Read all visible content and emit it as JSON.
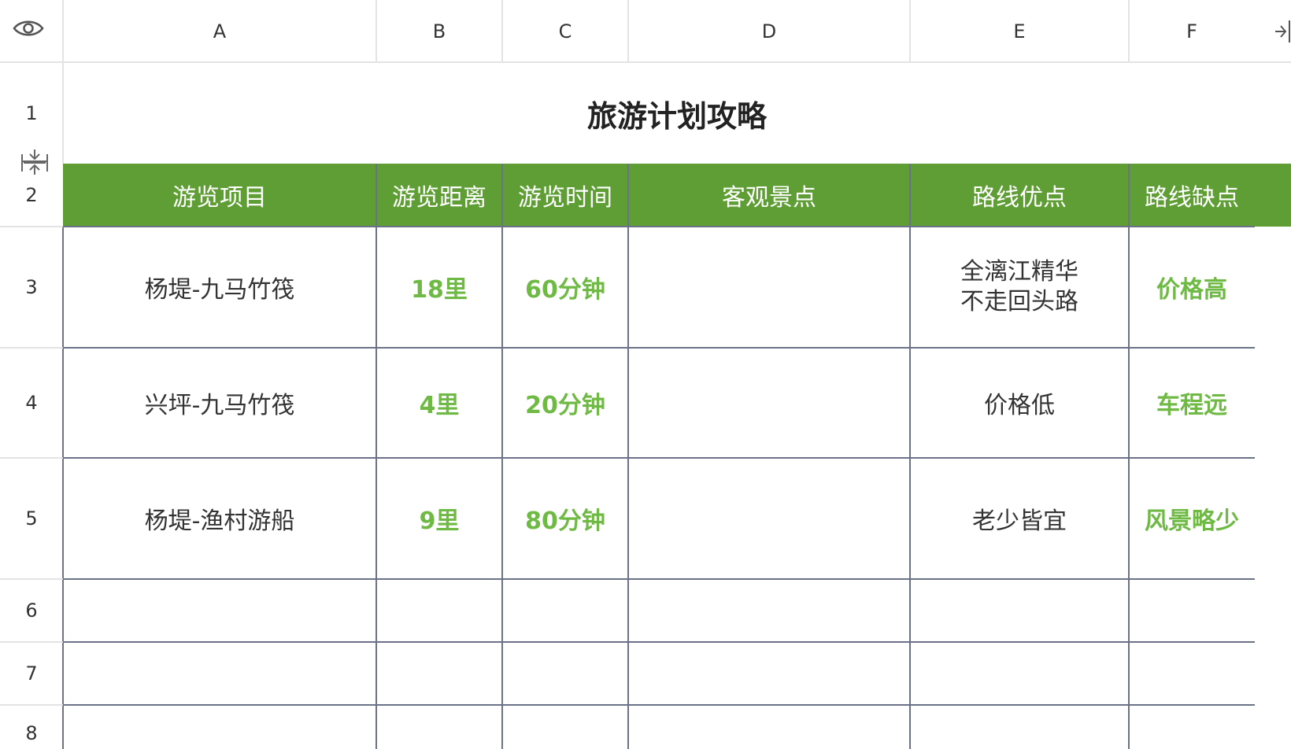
{
  "columns": [
    "A",
    "B",
    "C",
    "D",
    "E",
    "F"
  ],
  "rows": [
    "1",
    "2",
    "3",
    "4",
    "5",
    "6",
    "7",
    "8"
  ],
  "sheet": {
    "title": "旅游计划攻略",
    "header": [
      "游览项目",
      "游览距离",
      "游览时间",
      "客观景点",
      "路线优点",
      "路线缺点"
    ],
    "data": [
      {
        "item": "杨堤-九马竹筏",
        "distance": "18里",
        "time": "60分钟",
        "sight": "",
        "pros": [
          "全漓江精华",
          "不走回头路"
        ],
        "cons": "价格高"
      },
      {
        "item": "兴坪-九马竹筏",
        "distance": "4里",
        "time": "20分钟",
        "sight": "",
        "pros": [
          "价格低"
        ],
        "cons": "车程远"
      },
      {
        "item": "杨堤-渔村游船",
        "distance": "9里",
        "time": "80分钟",
        "sight": "",
        "pros": [
          "老少皆宜"
        ],
        "cons": "风景略少"
      }
    ]
  },
  "colors": {
    "header_bg": "#5f9e35",
    "accent_text": "#6fba45",
    "grid": "#6b7186"
  },
  "icons": {
    "view": "eye-icon",
    "collapse": "collapse-panel-icon",
    "row_resize": "row-resize-icon"
  }
}
